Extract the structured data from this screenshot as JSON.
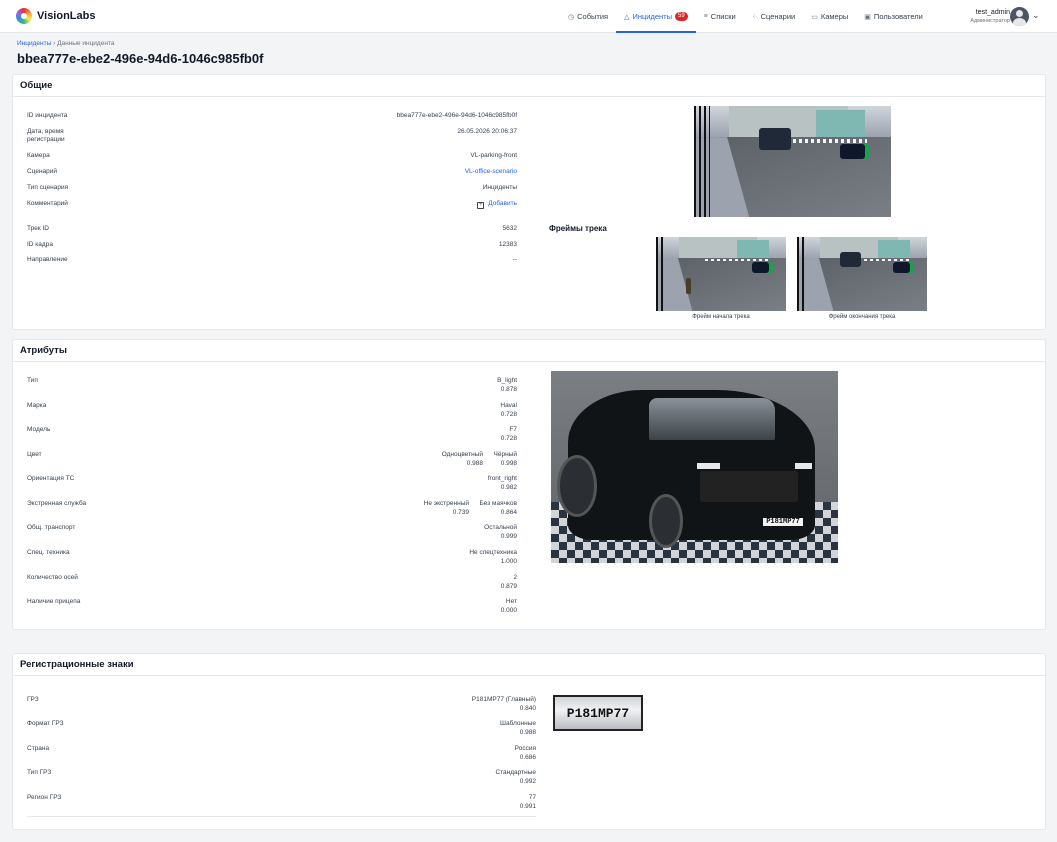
{
  "header": {
    "logo_text": "VisionLabs",
    "nav": [
      {
        "label": "События",
        "icon": "clock-icon"
      },
      {
        "label": "Инциденты",
        "icon": "alert-icon",
        "badge": "59",
        "active": true
      },
      {
        "label": "Списки",
        "icon": "list-icon"
      },
      {
        "label": "Сценарии",
        "icon": "scenario-icon"
      },
      {
        "label": "Камеры",
        "icon": "camera-icon"
      },
      {
        "label": "Пользователи",
        "icon": "users-icon"
      }
    ],
    "user_name": "test_admin",
    "user_role": "Администратор"
  },
  "breadcrumb": {
    "root": "Инциденты",
    "separator": "›",
    "current": "Данные инцидента"
  },
  "title": "bbea777e-ebe2-496e-94d6-1046c985fb0f",
  "general": {
    "heading": "Общие",
    "rows": [
      {
        "label": "ID инцидента",
        "value": "bbea777e-ebe2-496e-94d6-1046c985fb0f"
      },
      {
        "label": "Дата, время регистрации",
        "value": "26.05.2026 20:06:37"
      },
      {
        "label": "Камера",
        "value": "VL-parking-front"
      },
      {
        "label": "Сценарий",
        "value": "VL-office-scenario"
      },
      {
        "label": "Тип сценария",
        "value": "Инциденты"
      },
      {
        "label": "Комментарий",
        "value": "Добавить"
      },
      {
        "label": "Трек ID",
        "value": "5632"
      },
      {
        "label": "ID кадра",
        "value": "12383"
      },
      {
        "label": "Направление",
        "value": "--"
      }
    ],
    "frames_heading": "Фреймы трека",
    "frame_start_caption": "Фрейм начала трека",
    "frame_end_caption": "Фрейм окончания трека"
  },
  "attributes": {
    "heading": "Атрибуты",
    "rows": [
      {
        "label": "Тип",
        "values": [
          {
            "value": "B_light",
            "score": "0.878"
          }
        ]
      },
      {
        "label": "Марка",
        "values": [
          {
            "value": "Haval",
            "score": "0.728"
          }
        ]
      },
      {
        "label": "Модель",
        "values": [
          {
            "value": "F7",
            "score": "0.728"
          }
        ]
      },
      {
        "label": "Цвет",
        "values": [
          {
            "value": "Одноцветный",
            "score": "0.988"
          },
          {
            "value": "Чёрный",
            "score": "0.998"
          }
        ]
      },
      {
        "label": "Ориентация ТС",
        "values": [
          {
            "value": "front_right",
            "score": "0.982"
          }
        ]
      },
      {
        "label": "Экстренная служба",
        "values": [
          {
            "value": "Не экстренный",
            "score": "0.739"
          },
          {
            "value": "Без маячков",
            "score": "0.864"
          }
        ]
      },
      {
        "label": "Общ. транспорт",
        "values": [
          {
            "value": "Остальной",
            "score": "0.999"
          }
        ]
      },
      {
        "label": "Спец. техника",
        "values": [
          {
            "value": "Не спецтехника",
            "score": "1.000"
          }
        ]
      },
      {
        "label": "Количество осей",
        "values": [
          {
            "value": "2",
            "score": "0.879"
          }
        ]
      },
      {
        "label": "Наличие прицепа",
        "values": [
          {
            "value": "Нет",
            "score": "0.000"
          }
        ]
      }
    ],
    "plate_text": "Р181МР77"
  },
  "plates": {
    "heading": "Регистрационные знаки",
    "rows": [
      {
        "label": "ГРЗ",
        "value": "Р181МР77 (Главный)",
        "score": "0.840"
      },
      {
        "label": "Формат ГРЗ",
        "value": "Шаблонные",
        "score": "0.988"
      },
      {
        "label": "Страна",
        "value": "Россия",
        "score": "0.686"
      },
      {
        "label": "Тип ГРЗ",
        "value": "Стандартные",
        "score": "0.992"
      },
      {
        "label": "Регион ГРЗ",
        "value": "77",
        "score": "0.991"
      }
    ],
    "plate_crop_text": "Р181МР77"
  }
}
